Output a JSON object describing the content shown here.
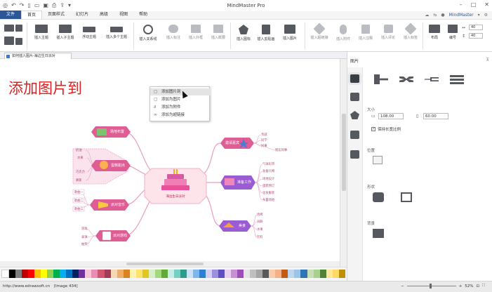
{
  "window": {
    "title": "MindMaster Pro",
    "user": "MindMaster"
  },
  "menu": {
    "tabs": [
      "文件",
      "首页",
      "页面样式",
      "幻灯片",
      "高级",
      "视图",
      "帮助"
    ]
  },
  "ribbon": {
    "buttons": [
      "插入主题",
      "插入子主题",
      "浮动主题",
      "插入多个主题",
      "插入关系线",
      "插入标注",
      "插入外框",
      "插入概要",
      "插入图标",
      "插入剪贴画",
      "插入图片",
      "插入超链接",
      "插入附件",
      "插入注释",
      "插入评论",
      "插入标签",
      "布局",
      "编号"
    ],
    "spin_a": "40",
    "spin_b": "40"
  },
  "document_tab": "如何插入图片-海边生日派对",
  "canvas": {
    "overlay_title": "添加图片到",
    "context_menu": [
      "添加图片到",
      "添加为图片",
      "添加为附件",
      "添加为超链接"
    ],
    "center_topic": "海边生日派对",
    "topics_left": [
      "场地布置",
      "蛋糕甜点",
      "派对音乐",
      "派对游戏"
    ],
    "topics_right": [
      "邀请嘉宾",
      "准备工作",
      "美食"
    ],
    "subtopics": {
      "invite": [
        "亲戚",
        "同学",
        "同事",
        "朋友同事"
      ],
      "prep": [
        "气球彩带",
        "准备礼物",
        "场地设计",
        "蛋糕预订",
        "化妆服装",
        "布置场地"
      ],
      "food": [
        "烧烤",
        "海鲜",
        "水果",
        "饮料"
      ],
      "cake": [
        "奶油",
        "水果",
        "巧克力",
        "慕斯"
      ],
      "music": [
        "歌曲一",
        "歌曲二",
        "歌曲三"
      ],
      "games": [
        "游戏",
        "表演",
        "抽奖"
      ]
    }
  },
  "panel": {
    "title": "图片",
    "size_label": "大小",
    "width": "108.00",
    "height": "60.00",
    "keep_ratio": "保持长宽比例",
    "position_label": "位置",
    "shape_label": "形状",
    "background_label": "背景"
  },
  "status": {
    "url": "http://www.edrawsoft.cn",
    "image_info": "[Image 434]",
    "zoom": "52%"
  },
  "colors": {
    "accent": "#2b579a",
    "mindmap_pink": "#e05c95",
    "mindmap_purple": "#9b5bd3",
    "title_red": "#e02020"
  }
}
